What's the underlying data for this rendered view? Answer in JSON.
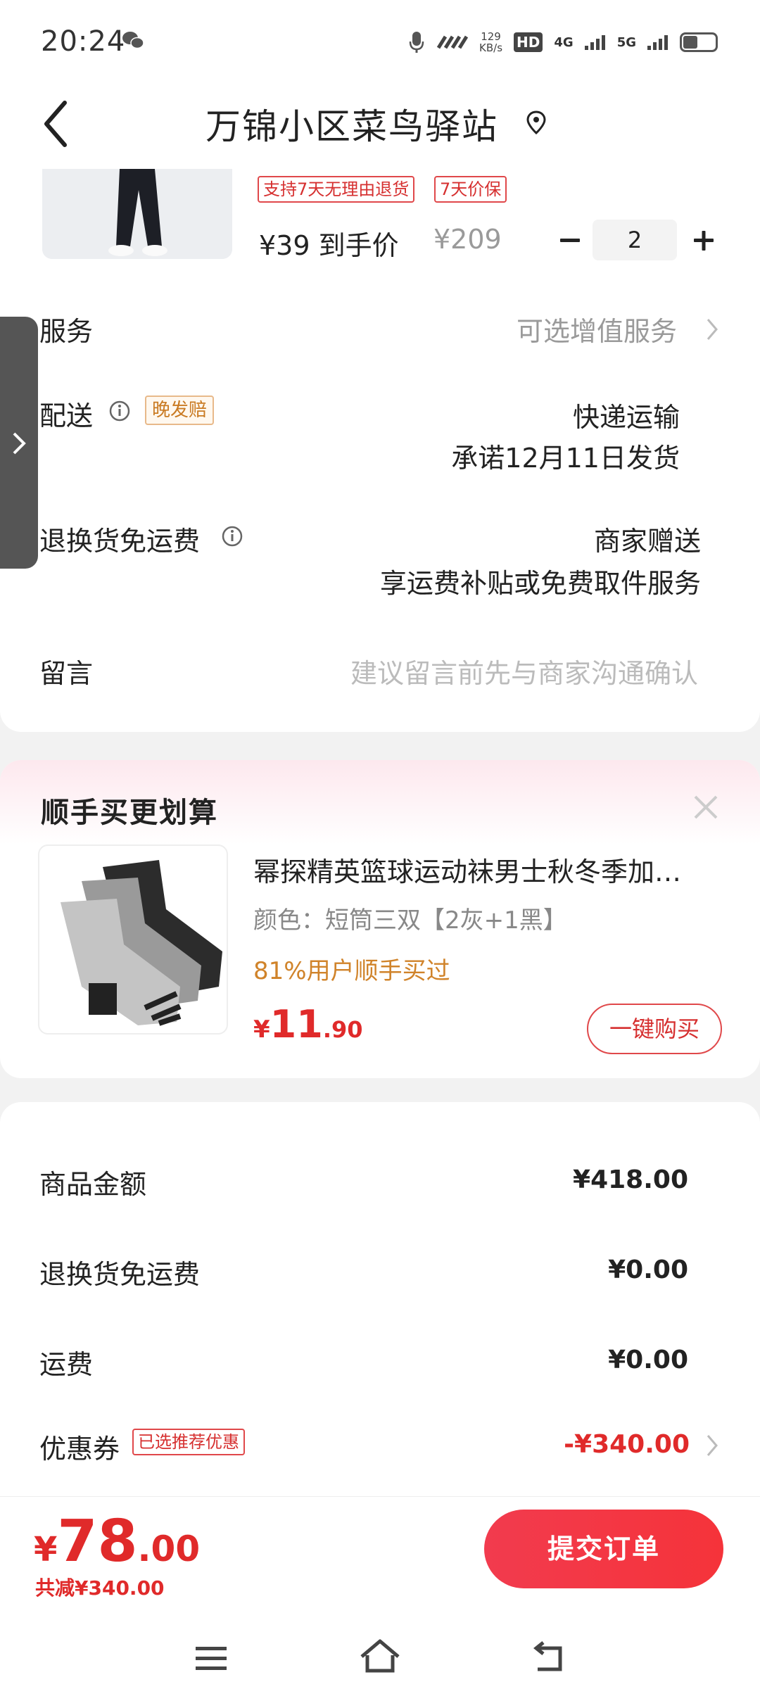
{
  "status_bar": {
    "time": "20:24",
    "speed_value": "129",
    "speed_unit": "KB/s",
    "hd_label": "HD",
    "net_4g": "4G",
    "net_5g": "5G"
  },
  "header": {
    "title": "万锦小区菜鸟驿站"
  },
  "product": {
    "tags": [
      "支持7天无理由退货",
      "7天价保"
    ],
    "price_label": "¥39 到手价",
    "original_price": "¥209",
    "quantity": "2"
  },
  "rows": {
    "service_label": "服务",
    "service_value": "可选增值服务",
    "delivery_label": "配送",
    "delivery_badge": "晚发赔",
    "delivery_method": "快递运输",
    "delivery_promise": "承诺12月11日发货",
    "return_label": "退换货免运费",
    "return_value": "商家赠送",
    "return_desc": "享运费补贴或免费取件服务",
    "message_label": "留言",
    "message_placeholder": "建议留言前先与商家沟通确认"
  },
  "recommend": {
    "title": "顺手买更划算",
    "name": "幂探精英篮球运动袜男士秋冬季加厚毛巾底",
    "spec": "颜色：短筒三双【2灰+1黑】",
    "ratio": "81%用户顺手买过",
    "price_yen": "¥",
    "price_int": "11",
    "price_dec": ".90",
    "buy_label": "一键购买"
  },
  "summary": {
    "goods_label": "商品金额",
    "goods_value": "¥418.00",
    "return_label": "退换货免运费",
    "return_value": "¥0.00",
    "shipping_label": "运费",
    "shipping_value": "¥0.00",
    "coupon_label": "优惠券",
    "coupon_tag": "已选推荐优惠",
    "coupon_value": "-¥340.00"
  },
  "bottom": {
    "total_yen": "¥",
    "total_int": "78",
    "total_dec": ".00",
    "reduced": "共减¥340.00",
    "submit_label": "提交订单"
  },
  "colors": {
    "accent_red": "#e02a2a",
    "orange": "#d0832a"
  }
}
